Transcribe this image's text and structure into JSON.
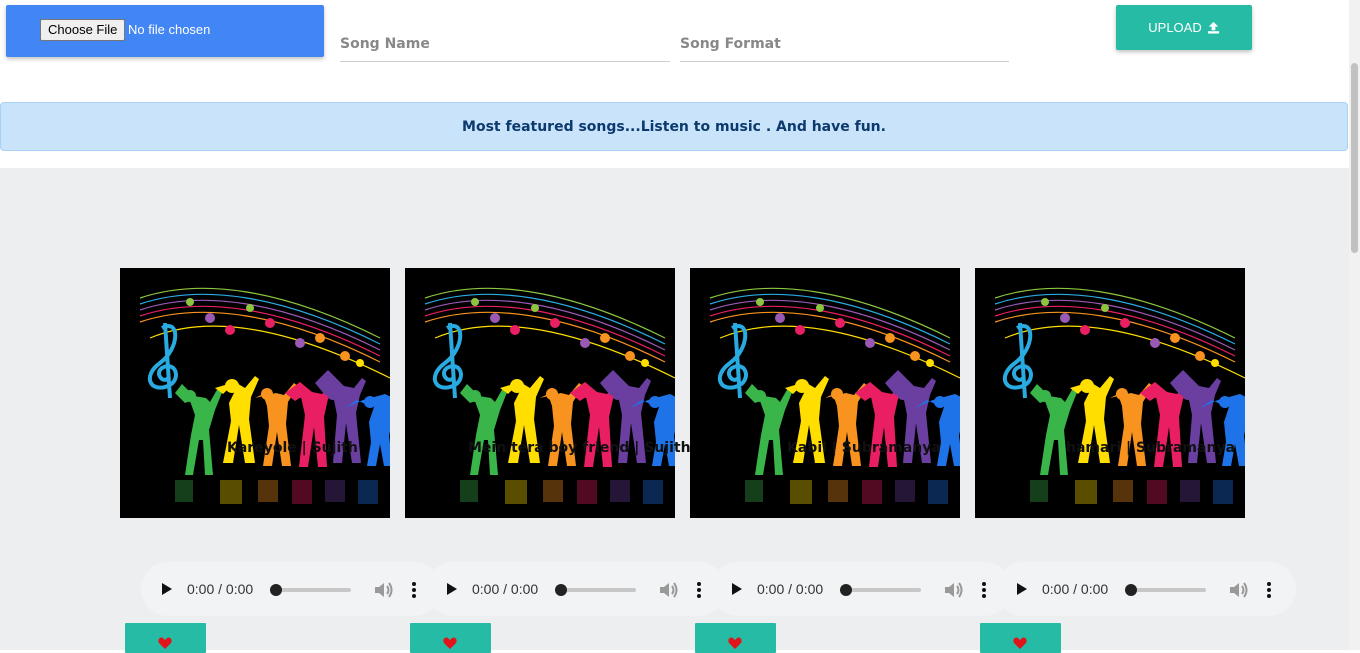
{
  "upload_form": {
    "choose_file_label": "Choose File",
    "file_status": "No file chosen",
    "song_name_placeholder": "Song Name",
    "song_format_placeholder": "Song Format",
    "upload_label": "UPLOAD",
    "upload_icon": "upload-icon"
  },
  "banner": {
    "text": "Most featured songs...Listen to music . And have fun."
  },
  "songs": [
    {
      "title": "Kareyole | Sujith",
      "time": "0:00 / 0:00"
    },
    {
      "title": "Mein tera boy friend | Sujith",
      "time": "0:00 / 0:00"
    },
    {
      "title": "Kabil | Subramanya",
      "time": "0:00 / 0:00"
    },
    {
      "title": "hamari | Subramanya",
      "time": "0:00 / 0:00"
    }
  ],
  "colors": {
    "file_box": "#4285f4",
    "accent": "#26bba5",
    "banner_bg": "#c9e3fb",
    "banner_text": "#0c3a6e",
    "content_bg": "#eceeef",
    "heart": "#e0141b"
  }
}
